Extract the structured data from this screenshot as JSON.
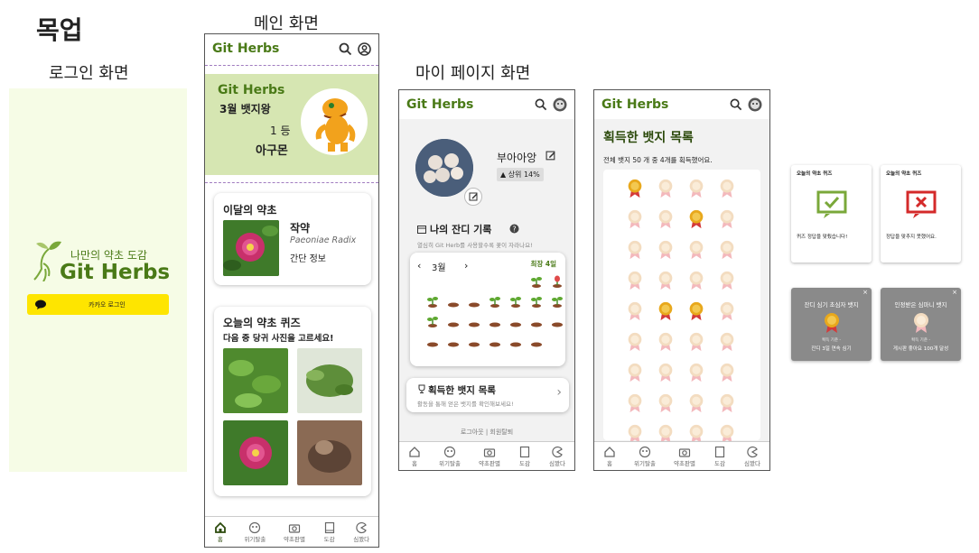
{
  "mockup_title": "목업",
  "login": {
    "section_title": "로그인 화면",
    "tagline": "나만의 약초 도감",
    "app_name": "Git Herbs",
    "kakao_label": "카카오 로그인"
  },
  "main": {
    "section_title": "메인 화면",
    "header_title": "Git Herbs",
    "banner": {
      "title": "Git Herbs",
      "subtitle": "3월 뱃지왕",
      "rank": "1 등",
      "name": "아구몬"
    },
    "monthly": {
      "title": "이달의 약초",
      "name": "작약",
      "latin": "Paeoniae Radix",
      "info": "간단 정보"
    },
    "quiz": {
      "title": "오늘의 약초 퀴즈",
      "question": "다음 중 당귀 사진을 고르세요!"
    },
    "nav": [
      "홈",
      "위기탈출",
      "약초판별",
      "도감",
      "심봤다"
    ]
  },
  "mypage": {
    "section_title": "마이 페이지 화면",
    "header_title": "Git Herbs",
    "username": "부아아앙",
    "rank": "▲ 상위 14%",
    "grass_title": "나의 잔디 기록",
    "grass_sub": "열심히 Git Herb를 사용할수록 꽃이 자라나요!",
    "month": "3월",
    "streak": "최장 4일",
    "grass": [
      "s",
      "r",
      "s",
      "p",
      "p",
      "s",
      "s",
      "s",
      "s",
      "s",
      "p",
      "p",
      "p",
      "p",
      "p",
      "p",
      "p",
      "p",
      "p",
      "p",
      "p",
      "p"
    ],
    "badge_link_title": "획득한 뱃지 목록",
    "badge_link_sub": "활동을 통해 얻은 뱃지를 확인해보세요!",
    "logout": "로그아웃",
    "withdraw": "회원탈퇴",
    "nav": [
      "홈",
      "위기탈출",
      "약초판별",
      "도감",
      "심봤다"
    ]
  },
  "badges": {
    "header_title": "Git Herbs",
    "title": "획득한 뱃지 목록",
    "summary": "전체 뱃지 50 개 중 4개를 획득했어요.",
    "earned": [
      0,
      6,
      17,
      18
    ],
    "count": 36,
    "nav": [
      "홈",
      "위기탈출",
      "약초판별",
      "도감",
      "심봤다"
    ]
  },
  "popups": {
    "correct": {
      "title": "오늘의 약초 퀴즈",
      "text": "퀴즈 정답을 맞췄습니다!"
    },
    "wrong": {
      "title": "오늘의 약초 퀴즈",
      "text": "정답을 맞추지 못했어요."
    },
    "badge1": {
      "title": "잔디 심기 초심자 뱃지",
      "small": "획득 기준 -",
      "text": "잔디 3일 연속 심기"
    },
    "badge2": {
      "title": "인정받은 심마니 뱃지",
      "small": "획득 기준 -",
      "text": "게시판 좋아요 100개 달성"
    }
  },
  "colors": {
    "brand": "#4a7a17",
    "login_bg": "#f6fce6",
    "banner_bg": "#d6e6b2",
    "kakao": "#fee500"
  }
}
